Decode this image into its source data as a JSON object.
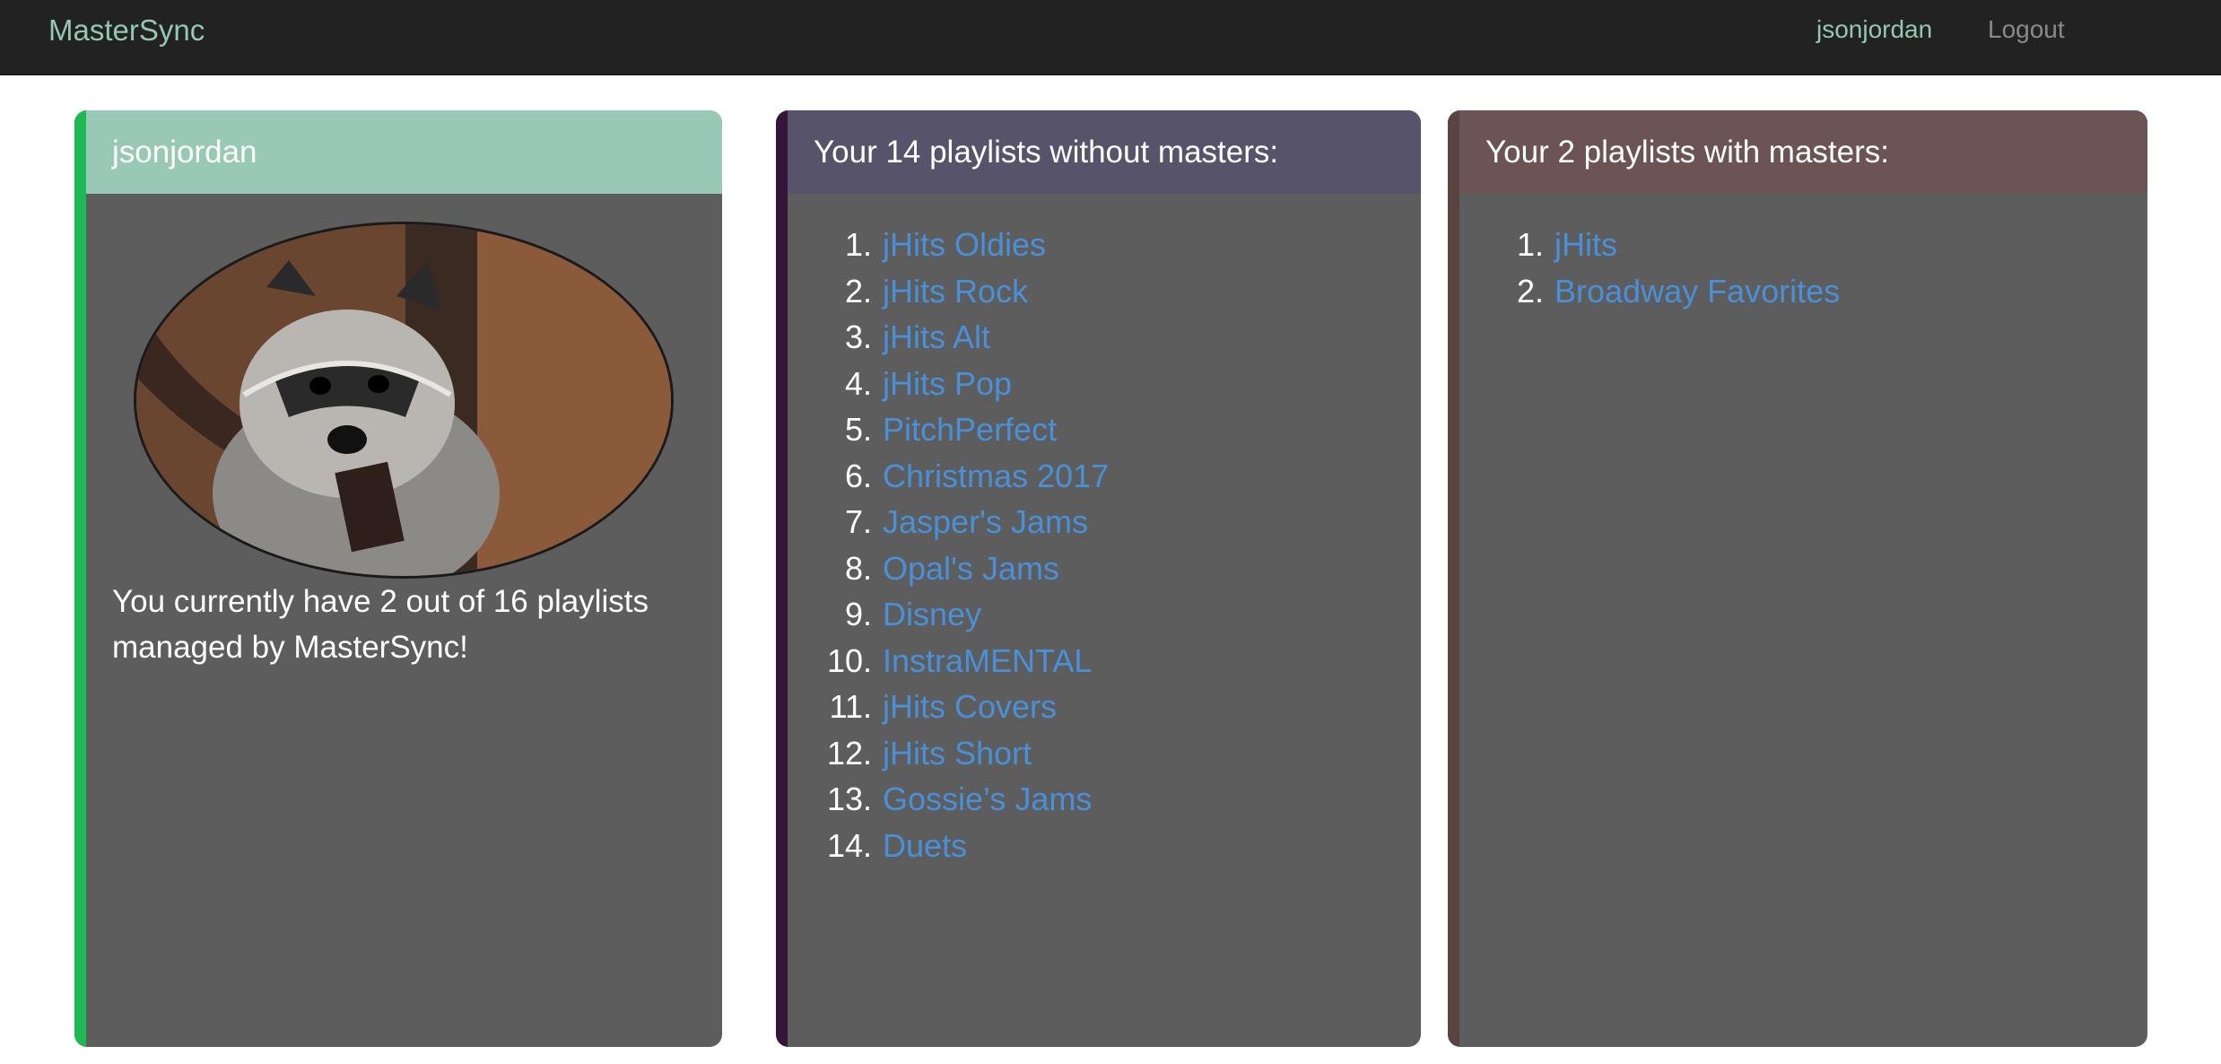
{
  "nav": {
    "brand": "MasterSync",
    "username": "jsonjordan",
    "logout": "Logout"
  },
  "profile": {
    "title": "jsonjordan",
    "avatar_icon": "raccoon-photo",
    "summary": "You currently have 2 out of 16 playlists managed by MasterSync!"
  },
  "without_masters": {
    "title": "Your 14 playlists without masters:",
    "items": [
      {
        "num": "1.",
        "label": "jHits Oldies"
      },
      {
        "num": "2.",
        "label": "jHits Rock"
      },
      {
        "num": "3.",
        "label": "jHits Alt"
      },
      {
        "num": "4.",
        "label": "jHits Pop"
      },
      {
        "num": "5.",
        "label": "PitchPerfect"
      },
      {
        "num": "6.",
        "label": "Christmas 2017"
      },
      {
        "num": "7.",
        "label": "Jasper's Jams"
      },
      {
        "num": "8.",
        "label": "Opal's Jams"
      },
      {
        "num": "9.",
        "label": "Disney"
      },
      {
        "num": "10.",
        "label": "InstraMENTAL"
      },
      {
        "num": "11.",
        "label": "jHits Covers"
      },
      {
        "num": "12.",
        "label": "jHits Short"
      },
      {
        "num": "13.",
        "label": "Gossie’s Jams"
      },
      {
        "num": "14.",
        "label": "Duets"
      }
    ]
  },
  "with_masters": {
    "title": "Your 2 playlists with masters:",
    "items": [
      {
        "num": "1.",
        "label": "jHits"
      },
      {
        "num": "2.",
        "label": "Broadway Favorites"
      }
    ]
  },
  "colors": {
    "navbar": "#222222",
    "brand": "#93c7b2",
    "link": "#4a90d9",
    "card_body": "#5d5d5d",
    "profile_header": "#98c9b6",
    "profile_accent": "#1db954",
    "without_header": "#57536b",
    "without_accent": "#35163a",
    "with_header": "#6b5453",
    "with_accent": "#5a4442"
  }
}
